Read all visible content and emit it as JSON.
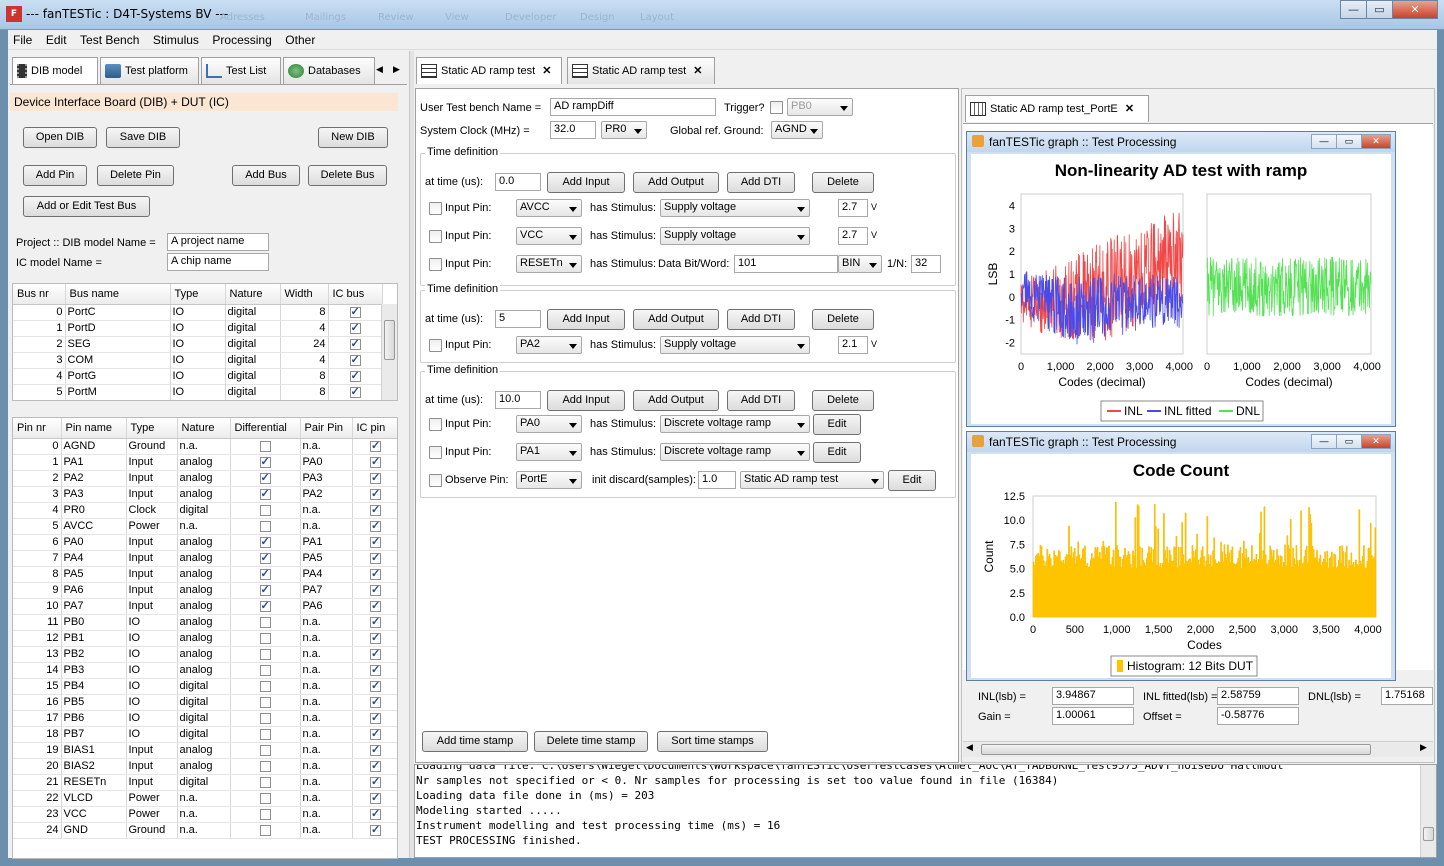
{
  "window": {
    "title": "--- fanTESTic : D4T-Systems BV ---",
    "ghost_menu": [
      "Adresses",
      "Mailings",
      "Review",
      "View",
      "Developer",
      "Design",
      "Layout"
    ]
  },
  "menu": [
    "File",
    "Edit",
    "Test Bench",
    "Stimulus",
    "Processing",
    "Other"
  ],
  "left_tabs": [
    "DIB model",
    "Test platform",
    "Test List",
    "Databases"
  ],
  "left": {
    "section_title": "Device Interface Board (DIB) + DUT (IC)",
    "buttons": {
      "open_dib": "Open DIB",
      "save_dib": "Save DIB",
      "new_dib": "New DIB",
      "add_pin": "Add Pin",
      "delete_pin": "Delete Pin",
      "add_bus": "Add Bus",
      "delete_bus": "Delete Bus",
      "add_edit_test_bus": "Add or Edit Test Bus"
    },
    "project_label": "Project :: DIB model Name =",
    "project_value": "A project name",
    "ic_label": "IC model Name =",
    "ic_value": "A chip name",
    "bus_columns": [
      "Bus nr",
      "Bus name",
      "Type",
      "Nature",
      "Width",
      "IC bus"
    ],
    "bus_rows": [
      [
        "0",
        "PortC",
        "IO",
        "digital",
        "8",
        true
      ],
      [
        "1",
        "PortD",
        "IO",
        "digital",
        "4",
        true
      ],
      [
        "2",
        "SEG",
        "IO",
        "digital",
        "24",
        true
      ],
      [
        "3",
        "COM",
        "IO",
        "digital",
        "4",
        true
      ],
      [
        "4",
        "PortG",
        "IO",
        "digital",
        "8",
        true
      ],
      [
        "5",
        "PortM",
        "IO",
        "digital",
        "8",
        true
      ]
    ],
    "pin_columns": [
      "Pin nr",
      "Pin name",
      "Type",
      "Nature",
      "Differential",
      "Pair Pin",
      "IC pin"
    ],
    "pin_rows": [
      [
        "0",
        "AGND",
        "Ground",
        "n.a.",
        false,
        "n.a.",
        true
      ],
      [
        "1",
        "PA1",
        "Input",
        "analog",
        true,
        "PA0",
        true
      ],
      [
        "2",
        "PA2",
        "Input",
        "analog",
        true,
        "PA3",
        true
      ],
      [
        "3",
        "PA3",
        "Input",
        "analog",
        true,
        "PA2",
        true
      ],
      [
        "4",
        "PR0",
        "Clock",
        "digital",
        false,
        "n.a.",
        true
      ],
      [
        "5",
        "AVCC",
        "Power",
        "n.a.",
        false,
        "n.a.",
        true
      ],
      [
        "6",
        "PA0",
        "Input",
        "analog",
        true,
        "PA1",
        true
      ],
      [
        "7",
        "PA4",
        "Input",
        "analog",
        true,
        "PA5",
        true
      ],
      [
        "8",
        "PA5",
        "Input",
        "analog",
        true,
        "PA4",
        true
      ],
      [
        "9",
        "PA6",
        "Input",
        "analog",
        true,
        "PA7",
        true
      ],
      [
        "10",
        "PA7",
        "Input",
        "analog",
        true,
        "PA6",
        true
      ],
      [
        "11",
        "PB0",
        "IO",
        "analog",
        false,
        "n.a.",
        true
      ],
      [
        "12",
        "PB1",
        "IO",
        "analog",
        false,
        "n.a.",
        true
      ],
      [
        "13",
        "PB2",
        "IO",
        "analog",
        false,
        "n.a.",
        true
      ],
      [
        "14",
        "PB3",
        "IO",
        "analog",
        false,
        "n.a.",
        true
      ],
      [
        "15",
        "PB4",
        "IO",
        "digital",
        false,
        "n.a.",
        true
      ],
      [
        "16",
        "PB5",
        "IO",
        "digital",
        false,
        "n.a.",
        true
      ],
      [
        "17",
        "PB6",
        "IO",
        "digital",
        false,
        "n.a.",
        true
      ],
      [
        "18",
        "PB7",
        "IO",
        "digital",
        false,
        "n.a.",
        true
      ],
      [
        "19",
        "BIAS1",
        "Input",
        "analog",
        false,
        "n.a.",
        true
      ],
      [
        "20",
        "BIAS2",
        "Input",
        "analog",
        false,
        "n.a.",
        true
      ],
      [
        "21",
        "RESETn",
        "Input",
        "digital",
        false,
        "n.a.",
        true
      ],
      [
        "22",
        "VLCD",
        "Power",
        "n.a.",
        false,
        "n.a.",
        true
      ],
      [
        "23",
        "VCC",
        "Power",
        "n.a.",
        false,
        "n.a.",
        true
      ],
      [
        "24",
        "GND",
        "Ground",
        "n.a.",
        false,
        "n.a.",
        true
      ]
    ]
  },
  "center_tabs": [
    "Static AD ramp test",
    "Static AD ramp test"
  ],
  "bench": {
    "name_label": "User Test bench Name =",
    "name_value": "AD rampDiff",
    "trigger_label": "Trigger?",
    "trigger_value": "PB0",
    "clock_label": "System Clock (MHz) =",
    "clock_value": "32.0",
    "clock_pin": "PR0",
    "ground_label": "Global ref. Ground:",
    "ground_value": "AGND",
    "time_def_label": "Time definition",
    "at_time_label": "at time (us):",
    "add_input": "Add Input",
    "add_output": "Add Output",
    "add_dti": "Add DTI",
    "delete": "Delete",
    "input_pin_label": "Input Pin:",
    "observe_pin_label": "Observe Pin:",
    "has_stimulus": "has Stimulus:",
    "edit": "Edit",
    "v_unit": "V",
    "td1_time": "0.0",
    "td1_r1_pin": "AVCC",
    "td1_r1_stim": "Supply voltage",
    "td1_r1_val": "2.7",
    "td1_r2_pin": "VCC",
    "td1_r2_stim": "Supply voltage",
    "td1_r2_val": "2.7",
    "td1_r3_pin": "RESETn",
    "td1_r3_stim_label": "Data Bit/Word:",
    "td1_r3_word": "101",
    "td1_r3_fmt": "BIN",
    "td1_r3_n_label": "1/N:",
    "td1_r3_n": "32",
    "td2_time": "5",
    "td2_r1_pin": "PA2",
    "td2_r1_stim": "Supply voltage",
    "td2_r1_val": "2.1",
    "td3_time": "10.0",
    "td3_r1_pin": "PA0",
    "td3_r1_stim": "Discrete voltage ramp",
    "td3_r2_pin": "PA1",
    "td3_r2_stim": "Discrete voltage ramp",
    "td3_r3_pin": "PortE",
    "td3_r3_discard_label": "init discard(samples):",
    "td3_r3_discard": "1.0",
    "td3_r3_test": "Static AD ramp test",
    "add_time_stamp": "Add time stamp",
    "delete_time_stamp": "Delete time stamp",
    "sort_time_stamps": "Sort time stamps"
  },
  "right_tab": "Static AD ramp test_PortE",
  "graph_window_title": "fanTESTic graph :: Test Processing",
  "chart_data": [
    {
      "type": "line",
      "title": "Non-linearity AD test with ramp",
      "ylabel": "LSB",
      "xlabel": "Codes (decimal)",
      "xlim": [
        0,
        4096
      ],
      "ylim": [
        -2.5,
        4.5
      ],
      "xticks": [
        "0",
        "1,000",
        "2,000",
        "3,000",
        "4,000"
      ],
      "yticks": [
        "-2",
        "-1",
        "0",
        "1",
        "2",
        "3",
        "4"
      ],
      "series": [
        {
          "name": "INL",
          "color": "#f04848",
          "x": [
            0,
            512,
            1024,
            1536,
            2048,
            2560,
            3072,
            3584,
            4095
          ],
          "y_min": [
            -1.2,
            -1.6,
            -1.8,
            -1.9,
            -2.0,
            -1.6,
            -1.2,
            -0.6,
            -0.3
          ],
          "y_max": [
            0.8,
            1.1,
            1.5,
            2.0,
            2.4,
            2.8,
            3.2,
            3.6,
            3.9
          ]
        },
        {
          "name": "INL fitted",
          "color": "#4a4ae8",
          "x": [
            0,
            512,
            1024,
            1536,
            2048,
            2560,
            3072,
            3584,
            4095
          ],
          "y_min": [
            -0.6,
            -1.4,
            -1.8,
            -2.2,
            -1.9,
            -1.7,
            -1.5,
            -1.3,
            -1.4
          ],
          "y_max": [
            1.2,
            1.0,
            0.9,
            0.9,
            1.0,
            1.1,
            1.0,
            1.0,
            0.8
          ]
        }
      ]
    },
    {
      "type": "line",
      "xlabel": "Codes (decimal)",
      "xlim": [
        0,
        4096
      ],
      "xticks": [
        "0",
        "1,000",
        "2,000",
        "3,000",
        "4,000"
      ],
      "series": [
        {
          "name": "DNL",
          "color": "#55e055",
          "x": [
            0,
            4095
          ],
          "y_min": [
            -0.85,
            -0.85
          ],
          "y_max": [
            1.75,
            1.75
          ]
        }
      ]
    },
    {
      "type": "bar",
      "title": "Code Count",
      "ylabel": "Count",
      "xlabel": "Codes",
      "xlim": [
        0,
        4096
      ],
      "ylim": [
        0,
        12.5
      ],
      "xticks": [
        "0",
        "500",
        "1,000",
        "1,500",
        "2,000",
        "2,500",
        "3,000",
        "3,500",
        "4,000"
      ],
      "yticks": [
        "0.0",
        "2.5",
        "5.0",
        "7.5",
        "10.0",
        "12.5"
      ],
      "series": [
        {
          "name": "Histogram: 12 Bits DUT",
          "color": "#ffc400",
          "x_range": [
            0,
            4095
          ],
          "typical": [
            5.0,
            7.5
          ],
          "peak": 12.0
        }
      ]
    }
  ],
  "results": {
    "inl_label": "INL(lsb) =",
    "inl_value": "3.94867",
    "inl_fit_label": "INL fitted(lsb) =",
    "inl_fit_value": "2.58759",
    "dnl_label": "DNL(lsb) =",
    "dnl_value": "1.75168",
    "gain_label": "Gain =",
    "gain_value": "1.00061",
    "offset_label": "Offset =",
    "offset_value": "-0.58776"
  },
  "console": [
    "Loading data file: C:\\Users\\Wiegel\\Documents\\Workspace\\fanTESTic\\UserTestCases\\Atmel_AUC\\AT_TADBUKNL_Test9575_ADVT_noiseDU Hallmout",
    "Nr samples not specified or < 0. Nr samples for processing is set too value found in file (16384)",
    "Loading data file done in (ms) = 203",
    "Modeling started .....",
    "Instrument modelling and test processing time (ms) = 16",
    "TEST PROCESSING finished."
  ]
}
